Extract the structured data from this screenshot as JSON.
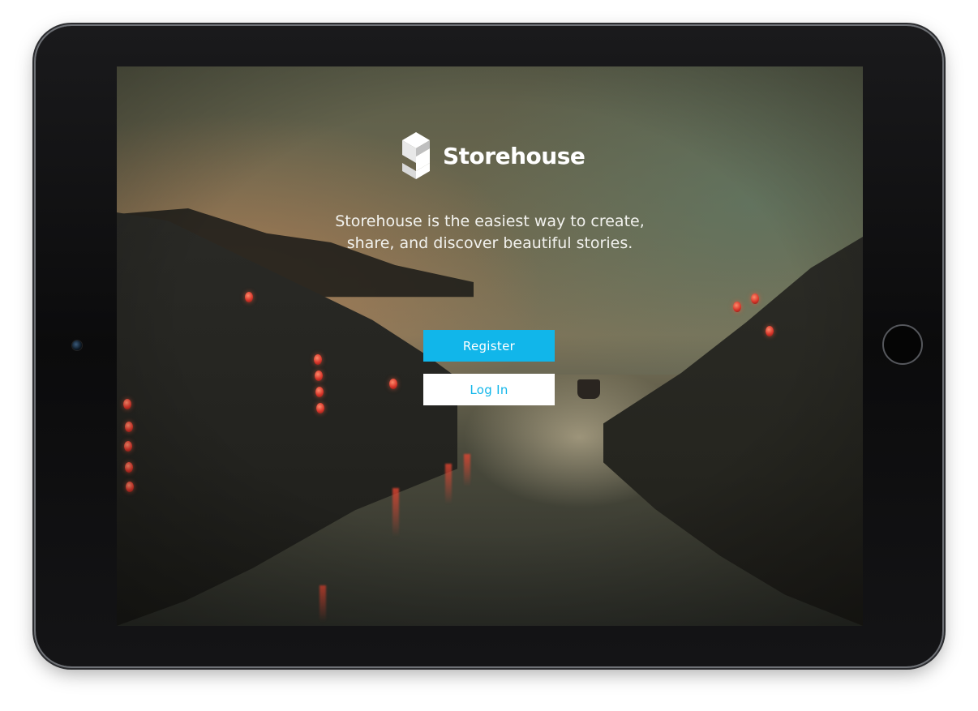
{
  "app": {
    "brand_name": "Storehouse",
    "logo_icon": "storehouse-logo-icon",
    "tagline": "Storehouse is the easiest way to create, share, and discover beautiful stories."
  },
  "actions": {
    "register_label": "Register",
    "login_label": "Log In"
  },
  "colors": {
    "accent": "#11b6ea",
    "button_text_light": "#ffffff",
    "login_background": "#ffffff"
  },
  "device": {
    "camera_icon": "front-camera-icon",
    "home_button_icon": "home-button-icon"
  }
}
